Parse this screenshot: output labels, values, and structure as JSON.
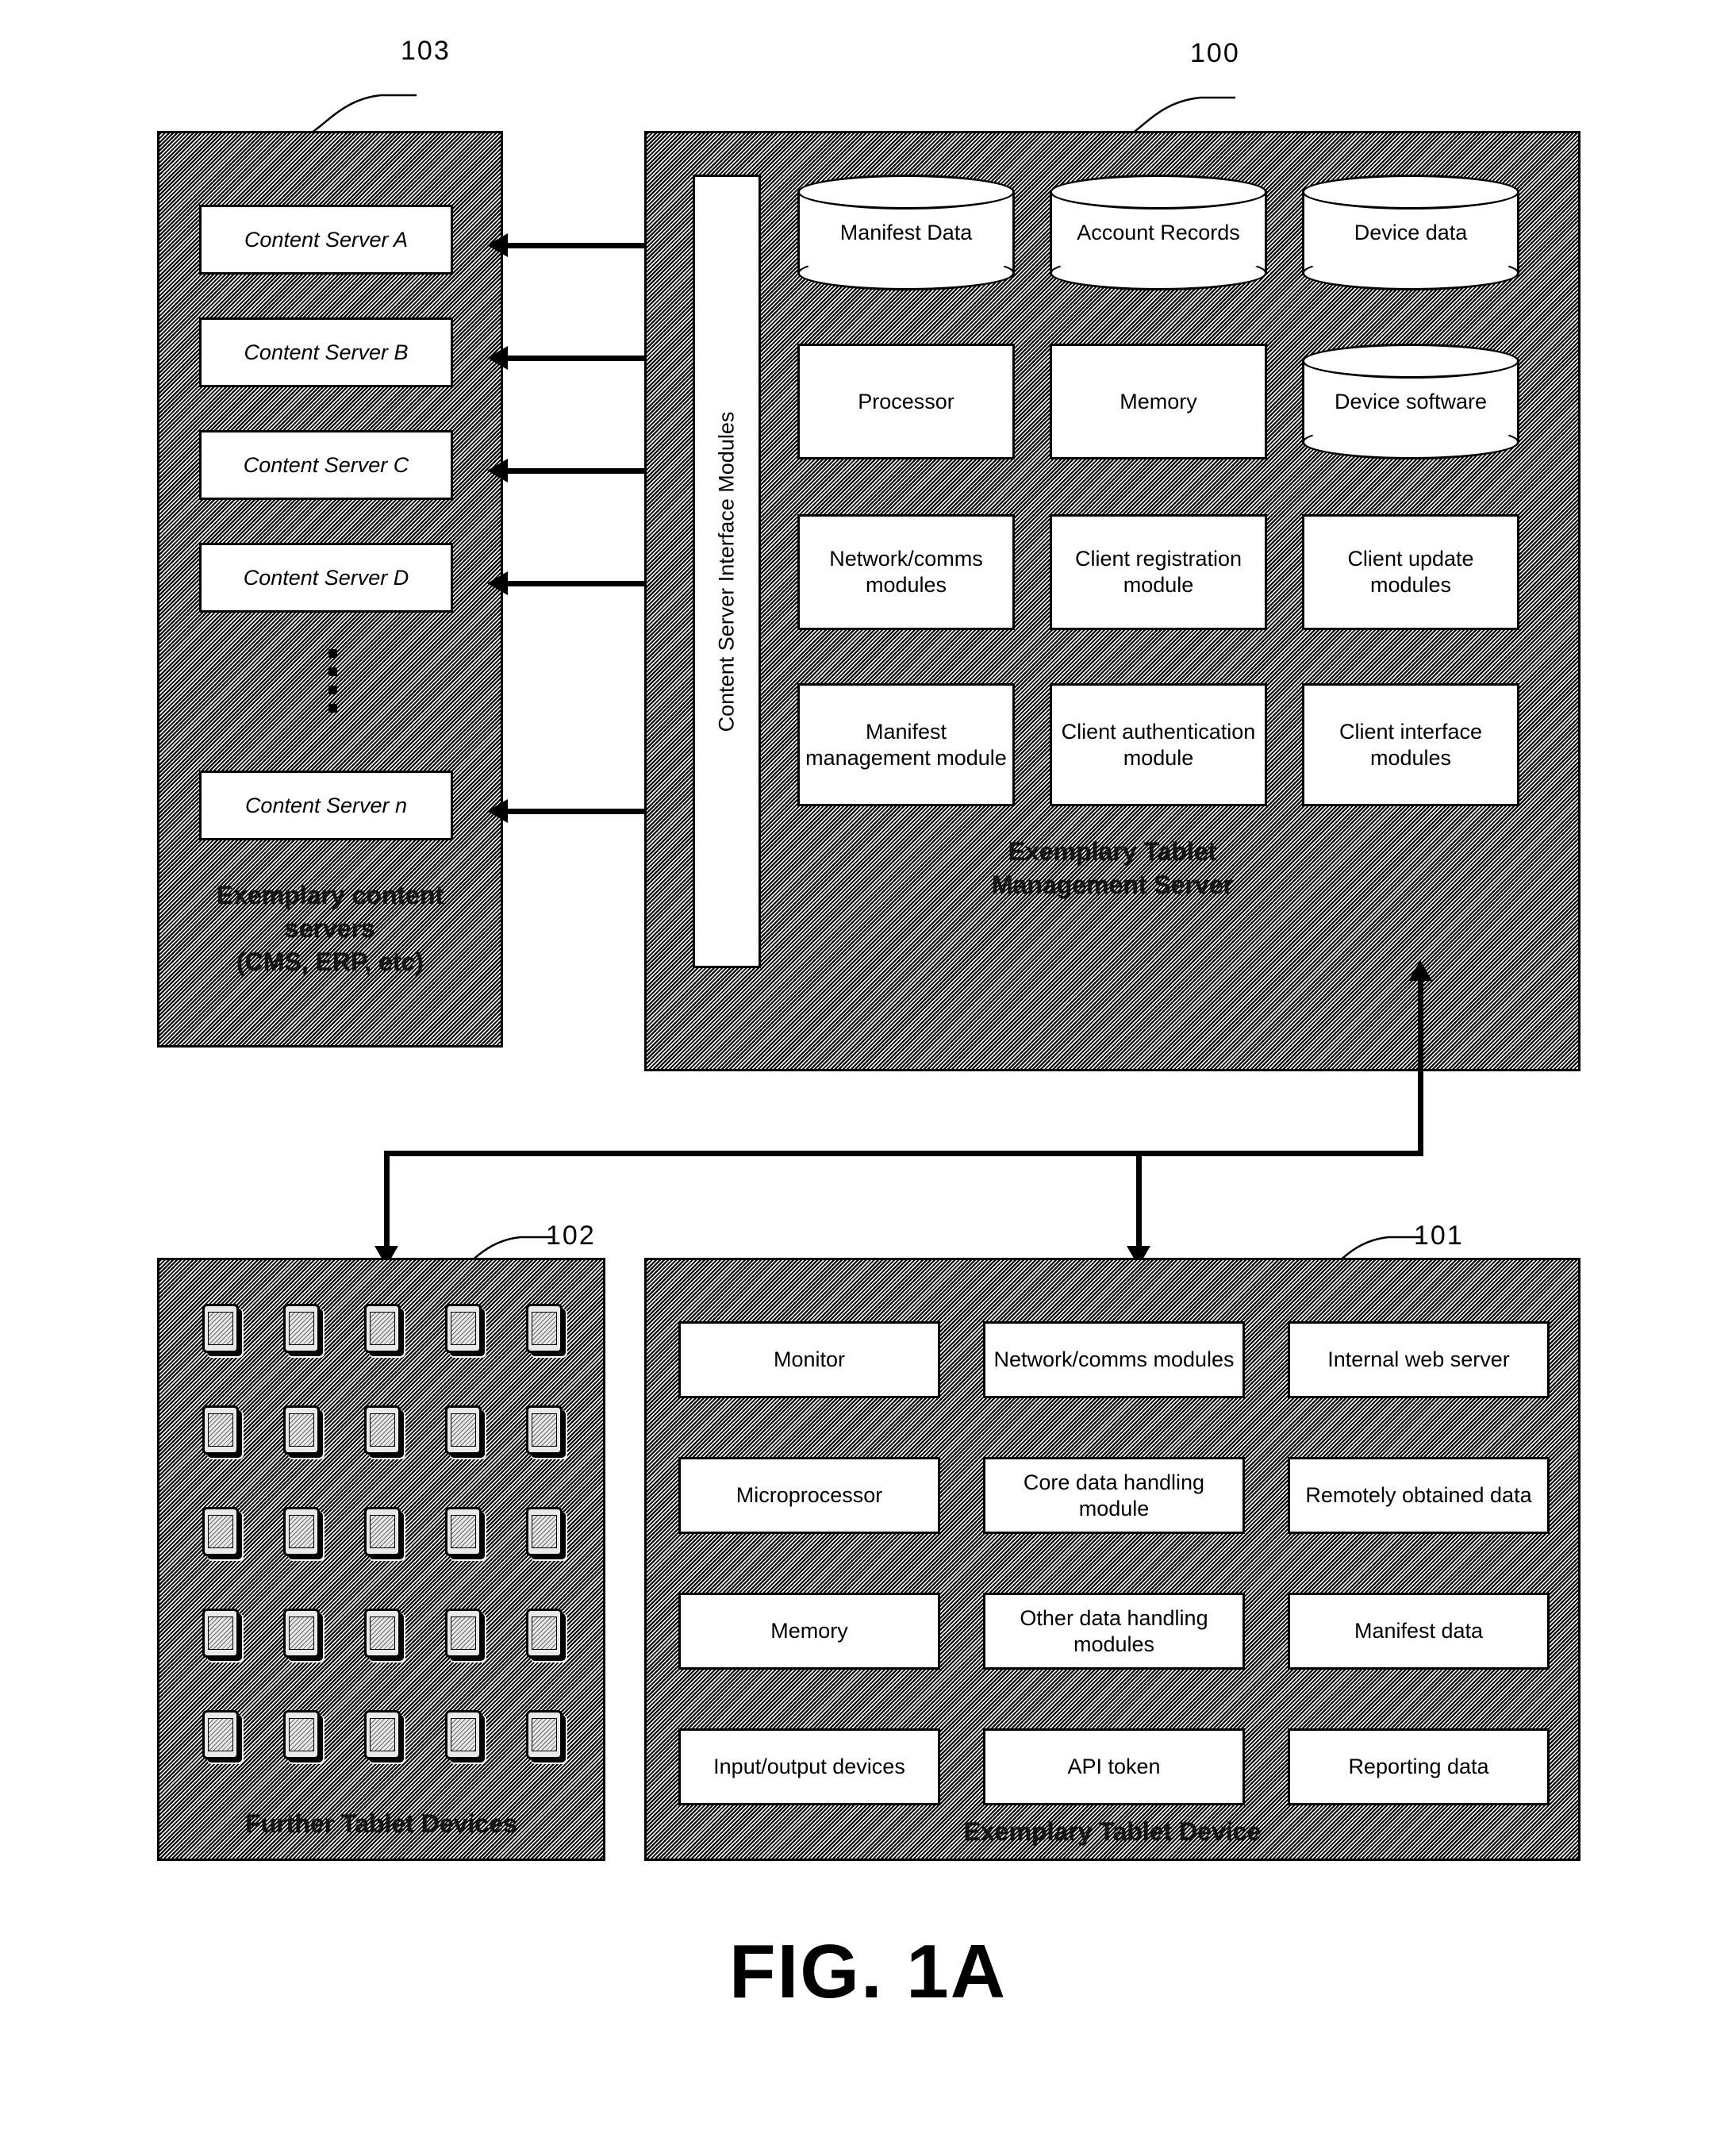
{
  "figure": {
    "title": "FIG. 1A"
  },
  "refs": {
    "content_servers": "103",
    "management_server": "100",
    "further_tablets": "102",
    "exemplary_tablet": "101"
  },
  "content_servers_panel": {
    "caption_line1": "Exemplary content",
    "caption_line2": "servers",
    "caption_line3": "(CMS, ERP, etc)",
    "servers": [
      {
        "label": "Content Server A"
      },
      {
        "label": "Content Server B"
      },
      {
        "label": "Content Server C"
      },
      {
        "label": "Content Server D"
      },
      {
        "label": "Content Server n"
      }
    ],
    "ellipsis": "vertical-dots"
  },
  "management_server_panel": {
    "caption_line1": "Exemplary Tablet",
    "caption_line2": "Management Server",
    "interface_label": "Content Server Interface Modules",
    "datastores": [
      {
        "label": "Manifest Data"
      },
      {
        "label": "Account Records"
      },
      {
        "label": "Device data"
      },
      {
        "label": "Device software"
      }
    ],
    "components": [
      {
        "label": "Processor"
      },
      {
        "label": "Memory"
      }
    ],
    "modules_row1": [
      {
        "label": "Network/comms modules"
      },
      {
        "label": "Client registration module"
      },
      {
        "label": "Client update modules"
      }
    ],
    "modules_row2": [
      {
        "label": "Manifest management module"
      },
      {
        "label": "Client authentication module"
      },
      {
        "label": "Client interface modules"
      }
    ]
  },
  "further_tablets_panel": {
    "caption": "Further Tablet Devices",
    "tablet_count": 25,
    "tablet_icon": "tablet-device-icon"
  },
  "exemplary_tablet_panel": {
    "caption": "Exemplary Tablet Device",
    "rows": [
      [
        {
          "label": "Monitor"
        },
        {
          "label": "Network/comms modules"
        },
        {
          "label": "Internal web server"
        }
      ],
      [
        {
          "label": "Microprocessor"
        },
        {
          "label": "Core data handling module"
        },
        {
          "label": "Remotely obtained data"
        }
      ],
      [
        {
          "label": "Memory"
        },
        {
          "label": "Other data handling modules"
        },
        {
          "label": "Manifest data"
        }
      ],
      [
        {
          "label": "Input/output devices"
        },
        {
          "label": "API token"
        },
        {
          "label": "Reporting data"
        }
      ]
    ]
  },
  "colors": {
    "ink": "#000000",
    "paper": "#ffffff"
  }
}
